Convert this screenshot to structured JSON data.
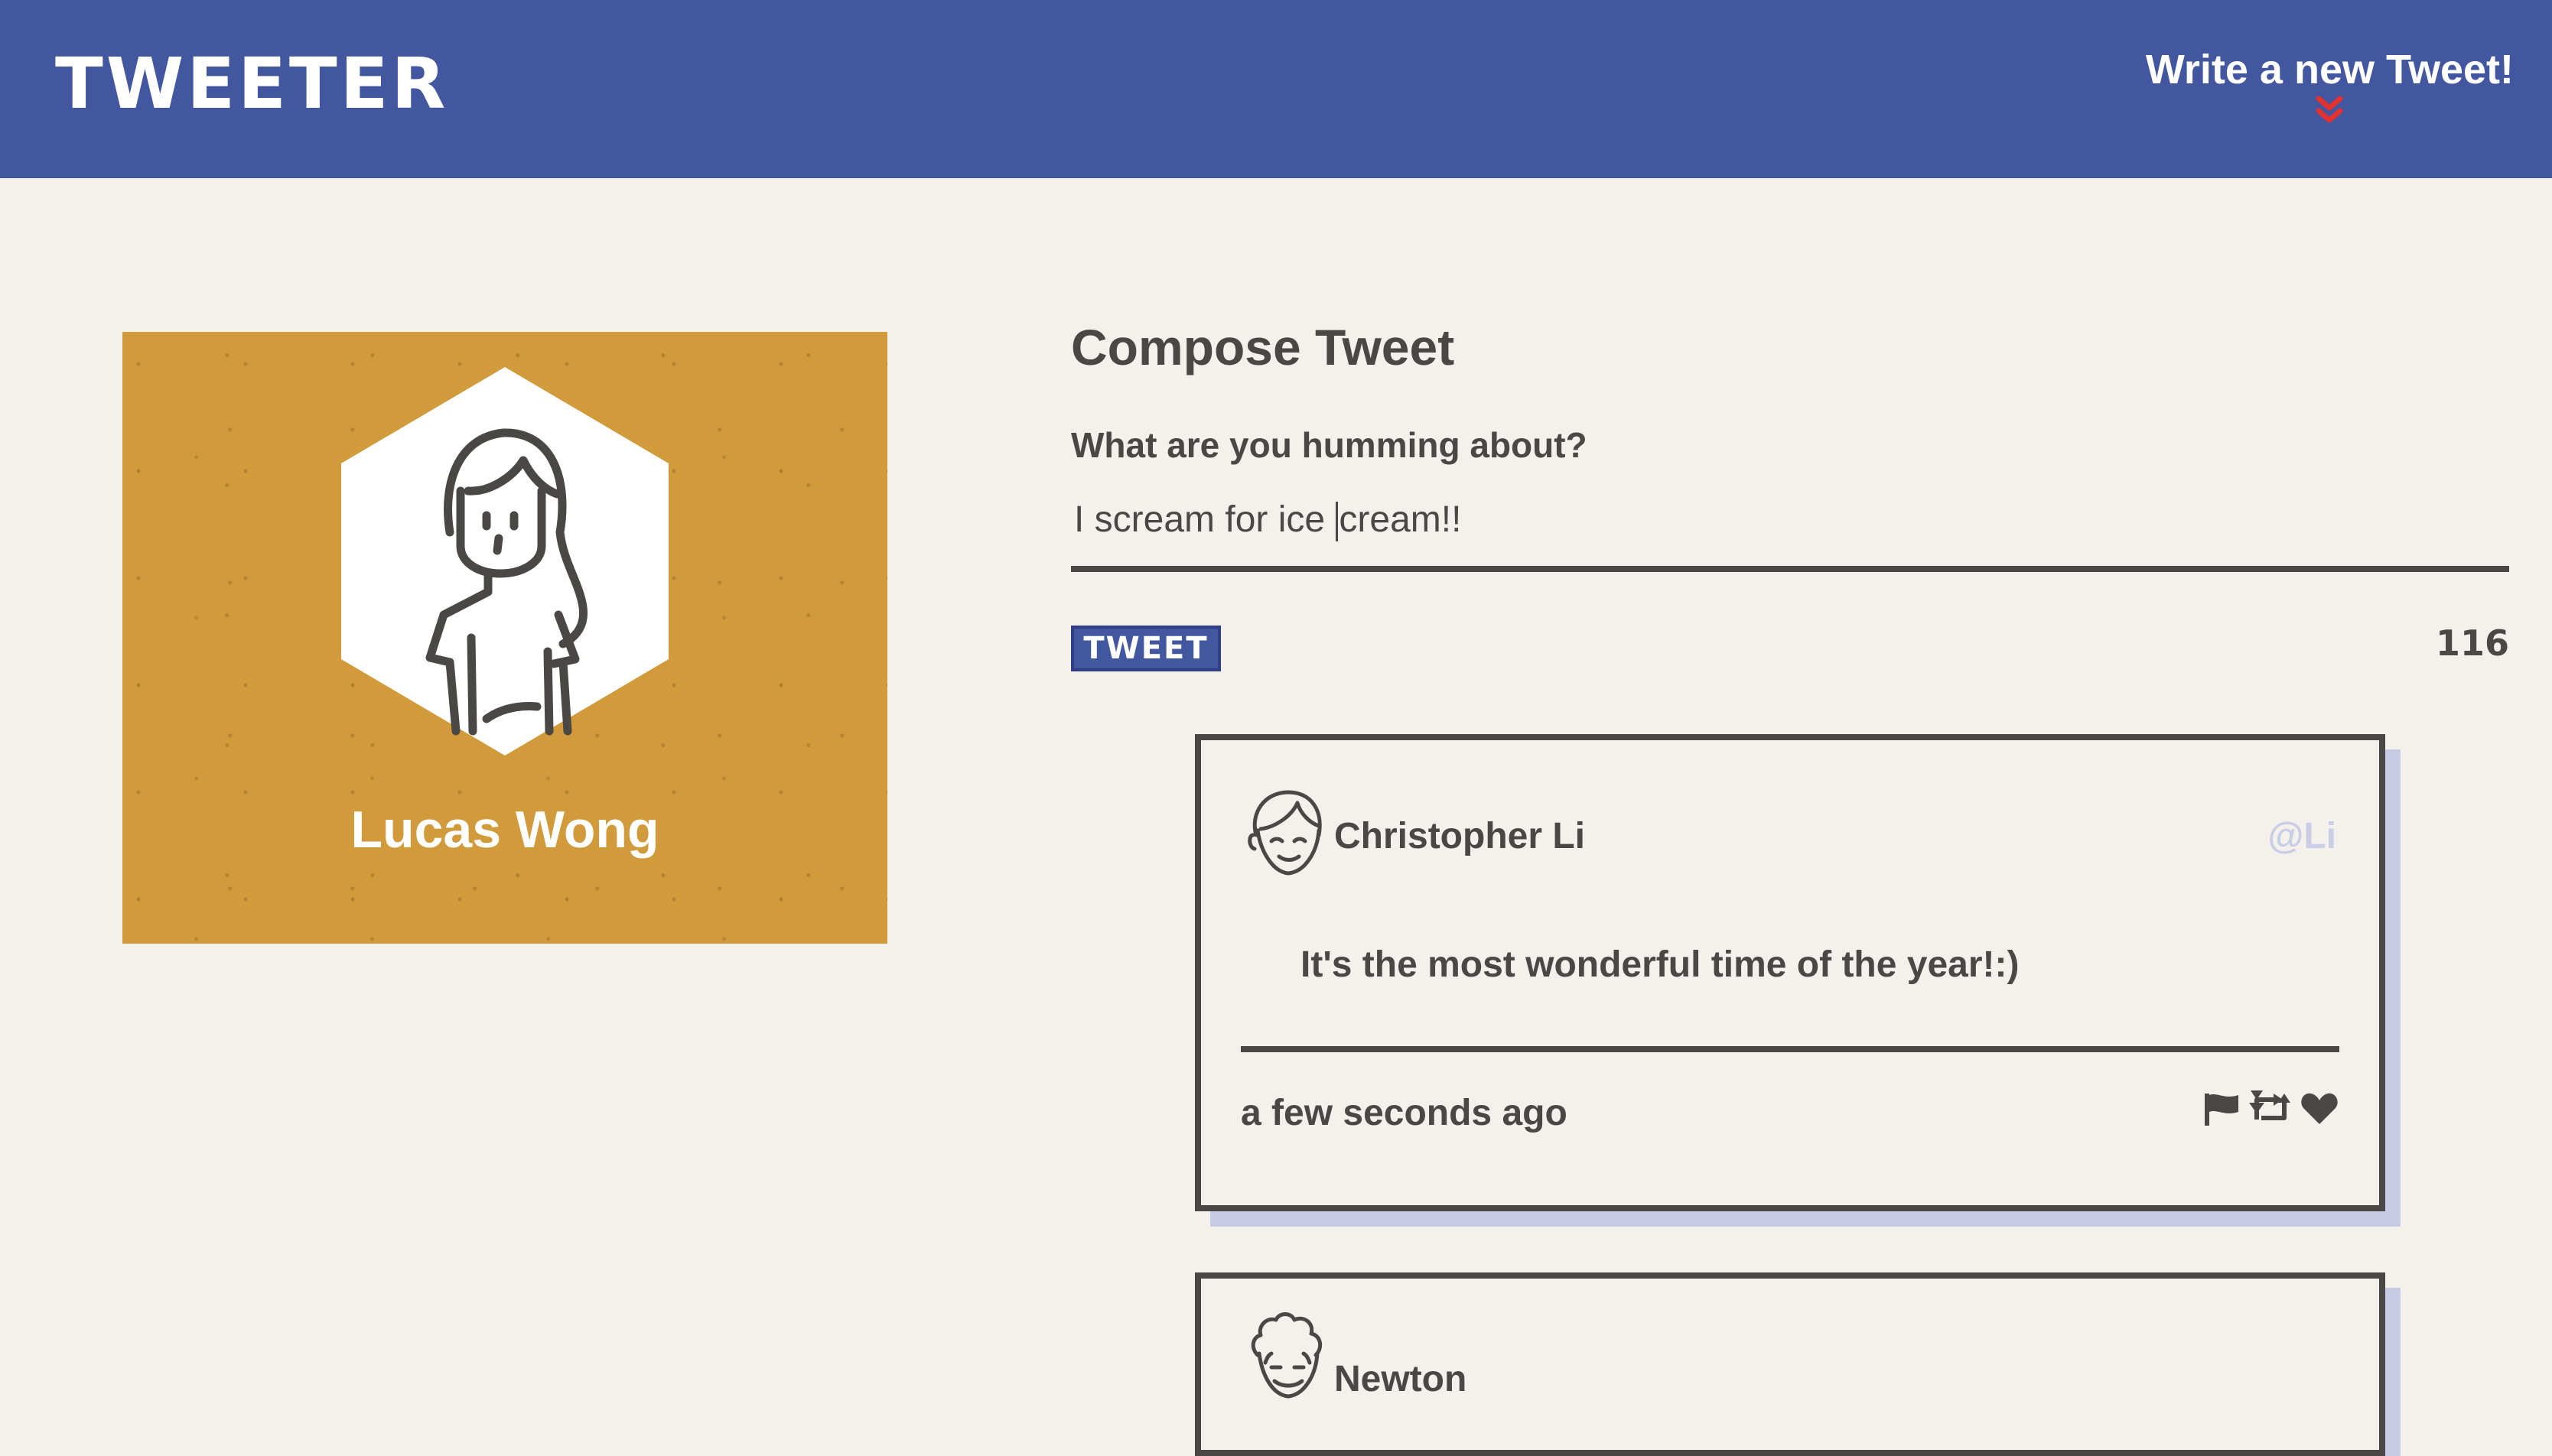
{
  "header": {
    "brand": "TWEETER",
    "compose_toggle_label": "Write a new Tweet!"
  },
  "profile": {
    "name": "Lucas Wong"
  },
  "compose": {
    "title": "Compose Tweet",
    "question": "What are you humming about?",
    "text_before_caret": "I scream for ice ",
    "text_after_caret": "cream!!",
    "button_label": "TWEET",
    "counter": "116"
  },
  "tweets": [
    {
      "name": "Christopher Li",
      "handle": "@Li",
      "content": "It's the most wonderful time of the year!:)",
      "time": "a few seconds ago"
    },
    {
      "name": "Newton"
    }
  ],
  "colors": {
    "header_bg": "#4356a0",
    "page_bg": "#f4f1ed",
    "profile_bg": "#d19a3a",
    "text": "#4a4845",
    "chevron": "#e0322f",
    "handle": "#c9cde6",
    "shadow": "#c7cbe4"
  },
  "icons": [
    "chevron-down-double-icon",
    "user-avatar-icon",
    "flag-icon",
    "retweet-icon",
    "heart-icon"
  ]
}
